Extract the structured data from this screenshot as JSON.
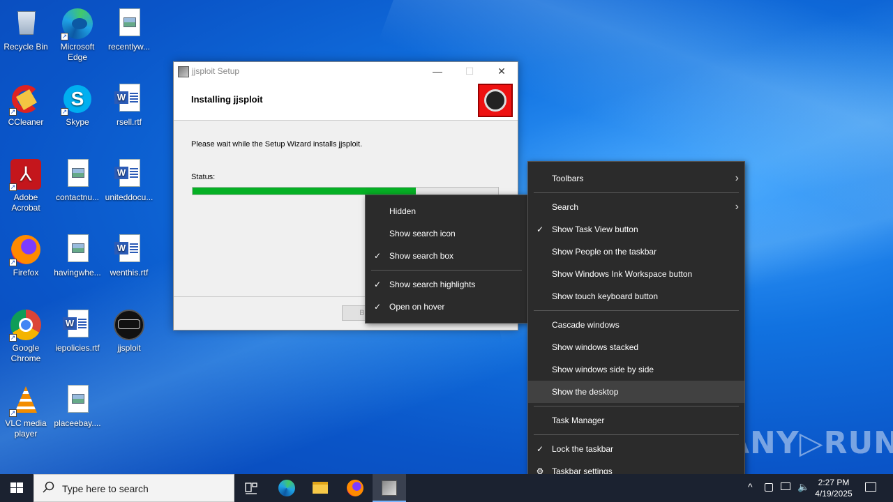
{
  "desktop": {
    "icons": [
      {
        "label": "Recycle Bin"
      },
      {
        "label": "Microsoft Edge"
      },
      {
        "label": "recentlyw..."
      },
      {
        "label": "CCleaner"
      },
      {
        "label": "Skype"
      },
      {
        "label": "rsell.rtf"
      },
      {
        "label": "Adobe Acrobat"
      },
      {
        "label": "contactnu..."
      },
      {
        "label": "uniteddocu..."
      },
      {
        "label": "Firefox"
      },
      {
        "label": "havingwhe..."
      },
      {
        "label": "wenthis.rtf"
      },
      {
        "label": "Google Chrome"
      },
      {
        "label": "iepolicies.rtf"
      },
      {
        "label": "jjsploit"
      },
      {
        "label": "VLC media player"
      },
      {
        "label": "placeebay...."
      }
    ]
  },
  "setup": {
    "title": "jjsploit Setup",
    "minimize": "—",
    "maximize": "☐",
    "close": "✕",
    "header_title": "Installing jjsploit",
    "description": "Please wait while the Setup Wizard installs jjsploit.",
    "status_label": "Status:",
    "progress": 0.73,
    "back_button": "Back"
  },
  "search_menu": {
    "items": [
      {
        "label": "Hidden",
        "checked": false
      },
      {
        "label": "Show search icon",
        "checked": false
      },
      {
        "label": "Show search box",
        "checked": true
      },
      {
        "label": "Show search highlights",
        "checked": true
      },
      {
        "label": "Open on hover",
        "checked": true
      }
    ]
  },
  "taskbar_menu": {
    "items": [
      {
        "label": "Toolbars"
      },
      {
        "label": "Search"
      },
      {
        "label": "Show Task View button"
      },
      {
        "label": "Show People on the taskbar"
      },
      {
        "label": "Show Windows Ink Workspace button"
      },
      {
        "label": "Show touch keyboard button"
      },
      {
        "label": "Cascade windows"
      },
      {
        "label": "Show windows stacked"
      },
      {
        "label": "Show windows side by side"
      },
      {
        "label": "Show the desktop"
      },
      {
        "label": "Task Manager"
      },
      {
        "label": "Lock the taskbar"
      },
      {
        "label": "Taskbar settings"
      }
    ]
  },
  "taskbar": {
    "search_placeholder": "Type here to search",
    "time": "2:27 PM",
    "date": "4/19/2025"
  },
  "watermark": "ANY▷RUN",
  "colors": {
    "progress": "#06b025",
    "menu_bg": "#2b2b2b",
    "taskbar_bg": "#1b2230"
  }
}
